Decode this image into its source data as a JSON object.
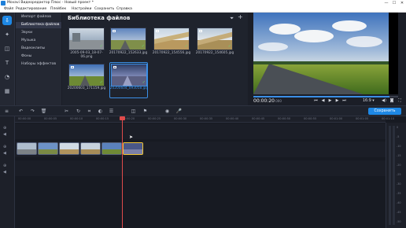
{
  "window": {
    "title": "Movavi Видеоредактор Плюс - Новый проект *",
    "controls": [
      "—",
      "☐",
      "✕"
    ]
  },
  "menu": [
    "Файл",
    "Редактирование",
    "Плейбек",
    "Настройки",
    "Сохранить",
    "Справка"
  ],
  "rail": {
    "icons": [
      "import-icon",
      "filters-icon",
      "transitions-icon",
      "titles-icon",
      "stickers-icon",
      "more-tools-icon"
    ]
  },
  "categories": [
    {
      "label": "Импорт файлов",
      "active": false
    },
    {
      "label": "Библиотека файлов",
      "active": true
    },
    {
      "label": "Звуки",
      "active": false
    },
    {
      "label": "Музыка",
      "active": false
    },
    {
      "label": "Видеоклипы",
      "active": false
    },
    {
      "label": "Фоны",
      "active": false
    },
    {
      "label": "Наборы эффектов",
      "active": false
    }
  ],
  "library": {
    "title": "Библиотека файлов",
    "filter_icon": "filter-icon",
    "add_icon": "add-icon",
    "files": [
      {
        "caption": "2005-09-03_18-07-06.png",
        "is_video": false,
        "selected": false
      },
      {
        "caption": "20170922_152633.jpg",
        "is_video": false,
        "selected": false
      },
      {
        "caption": "20170922_154556.jpg",
        "is_video": false,
        "selected": false
      },
      {
        "caption": "20170922_154605.jpg",
        "is_video": false,
        "selected": false
      },
      {
        "caption": "20200603_171159.jpg",
        "is_video": true,
        "selected": false
      },
      {
        "caption": "20200604_093058.jpg",
        "is_video": true,
        "selected": true
      }
    ]
  },
  "player": {
    "timecode": "00:00:20",
    "timecode_frac": ".000",
    "ratio": "16:9 ▾",
    "progress": 0.94,
    "controls": [
      "⏮",
      "◀",
      "▶",
      "▶",
      "⏭"
    ],
    "aux_icons": [
      "📷",
      "⛶"
    ]
  },
  "toolbar": {
    "export_label": "Сохранить"
  },
  "timeline": {
    "ticks": [
      "00:00:00",
      "00:00:05",
      "00:00:10",
      "00:00:15",
      "00:00:20",
      "00:00:25",
      "00:00:30",
      "00:00:35",
      "00:00:40",
      "00:00:45",
      "00:00:50",
      "00:00:55",
      "00:01:00",
      "00:01:05",
      "00:01:10"
    ],
    "clip_count": 6,
    "selected_clip": 5,
    "vu_labels": [
      "0",
      "-5",
      "-10",
      "-15",
      "-20",
      "-25",
      "-30",
      "-35",
      "-40",
      "-45",
      "-50"
    ]
  }
}
